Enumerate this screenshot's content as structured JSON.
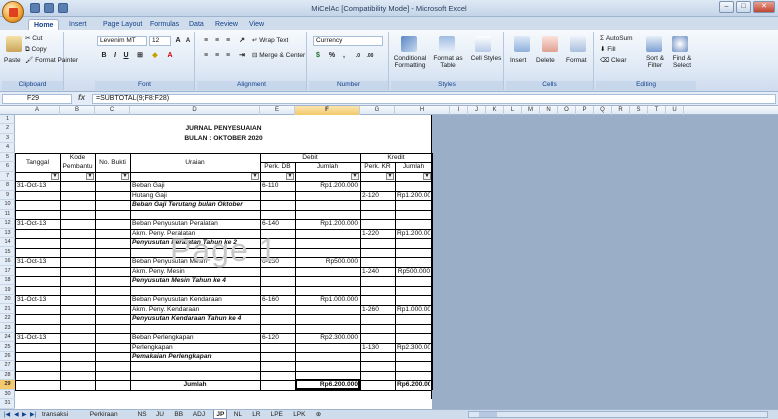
{
  "app": {
    "title": "MiCelAc  [Compatibility Mode] - Microsoft Excel"
  },
  "ribbon": {
    "tabs": [
      "Home",
      "Insert",
      "Page Layout",
      "Formulas",
      "Data",
      "Review",
      "View"
    ],
    "active_tab": "Home",
    "clipboard": {
      "paste": "Paste",
      "cut": "Cut",
      "copy": "Copy",
      "format_painter": "Format Painter",
      "label": "Clipboard"
    },
    "font": {
      "name": "Levenim MT",
      "size": "12",
      "label": "Font",
      "bold": "B",
      "italic": "I",
      "underline": "U",
      "grow": "A",
      "shrink": "A"
    },
    "alignment": {
      "wrap_text": "Wrap Text",
      "merge_center": "Merge & Center",
      "label": "Alignment"
    },
    "number": {
      "format": "Currency",
      "percent": "%",
      "comma": ",",
      "label": "Number"
    },
    "styles": {
      "conditional": "Conditional Formatting",
      "format_table": "Format as Table",
      "cell_styles": "Cell Styles",
      "label": "Styles"
    },
    "cells": {
      "insert": "Insert",
      "delete": "Delete",
      "format": "Format",
      "label": "Cells"
    },
    "editing": {
      "autosum": "AutoSum",
      "fill": "Fill",
      "clear": "Clear",
      "sort_filter": "Sort & Filter",
      "find_select": "Find & Select",
      "label": "Editing"
    }
  },
  "formula_bar": {
    "name_box": "F29",
    "fx": "fx",
    "formula": "=SUBTOTAL(9;F8:F28)"
  },
  "columns": [
    "A",
    "B",
    "C",
    "D",
    "E",
    "F",
    "G",
    "H",
    "I",
    "J",
    "K",
    "L",
    "M",
    "N",
    "O",
    "P",
    "Q",
    "R",
    "S",
    "T",
    "U"
  ],
  "selected_column": "F",
  "selected_row": "29",
  "rows": [
    "1",
    "2",
    "3",
    "4",
    "5",
    "6",
    "7",
    "8",
    "9",
    "10",
    "11",
    "12",
    "13",
    "14",
    "15",
    "16",
    "17",
    "18",
    "19",
    "20",
    "21",
    "22",
    "23",
    "24",
    "25",
    "26",
    "27",
    "28",
    "29",
    "30",
    "31"
  ],
  "sheet": {
    "title": "JURNAL PENYESUAIAN",
    "subtitle": "BULAN : OKTOBER 2020",
    "headers": {
      "tanggal": "Tanggal",
      "kode_pembantu": "Kode Pembantu",
      "no_bukti": "No. Bukti",
      "uraian": "Uraian",
      "debit": "Debit",
      "kredit": "Kredit",
      "perk_db": "Perk. DB",
      "jumlah_debit": "Jumlah",
      "perk_kr": "Perk. KR",
      "jumlah_kredit": "Jumlah"
    },
    "entries": [
      {
        "date": "31-Oct-13",
        "debit_account": "Beban Gaji",
        "debit_code": "6-110",
        "debit_amount": "Rp1.200.000",
        "credit_account": "Hutang Gaji",
        "credit_code": "2-120",
        "credit_amount": "Rp1.200.000",
        "note": "Beban Gaji Terutang bulan Oktober"
      },
      {
        "date": "31-Oct-13",
        "debit_account": "Beban Penyusutan Peralatan",
        "debit_code": "6-140",
        "debit_amount": "Rp1.200.000",
        "credit_account": "Akm. Peny. Peralatan",
        "credit_code": "1-220",
        "credit_amount": "Rp1.200.000",
        "note": "Penyusutan Peralatan Tahun ke 2"
      },
      {
        "date": "31-Oct-13",
        "debit_account": "Beban Penyusutan Mesin",
        "debit_code": "6-150",
        "debit_amount": "Rp500.000",
        "credit_account": "Akm. Peny. Mesin",
        "credit_code": "1-240",
        "credit_amount": "Rp500.000",
        "note": "Penyusutan Mesin Tahun ke 4"
      },
      {
        "date": "31-Oct-13",
        "debit_account": "Beban Penyusutan Kendaraan",
        "debit_code": "6-160",
        "debit_amount": "Rp1.000.000",
        "credit_account": "Akm. Peny. Kendaraan",
        "credit_code": "1-260",
        "credit_amount": "Rp1.000.000",
        "note": "Penyusutan Kendaraan Tahun ke 4"
      },
      {
        "date": "31-Oct-13",
        "debit_account": "Beban Perlengkapan",
        "debit_code": "6-120",
        "debit_amount": "Rp2.300.000",
        "credit_account": "Perlengkapan",
        "credit_code": "1-130",
        "credit_amount": "Rp2.300.000",
        "note": "Pemakaian Perlengkapan"
      }
    ],
    "total_label": "Jumlah",
    "total_debit": "Rp6.200.000",
    "total_kredit": "Rp6.200.000",
    "watermark": "Page 1"
  },
  "sheet_tabs": [
    "transaksi",
    "Perkiraan",
    "NS",
    "JU",
    "BB",
    "ADJ",
    "JP",
    "NL",
    "LR",
    "LPE",
    "LPK"
  ],
  "active_sheet": "JP"
}
